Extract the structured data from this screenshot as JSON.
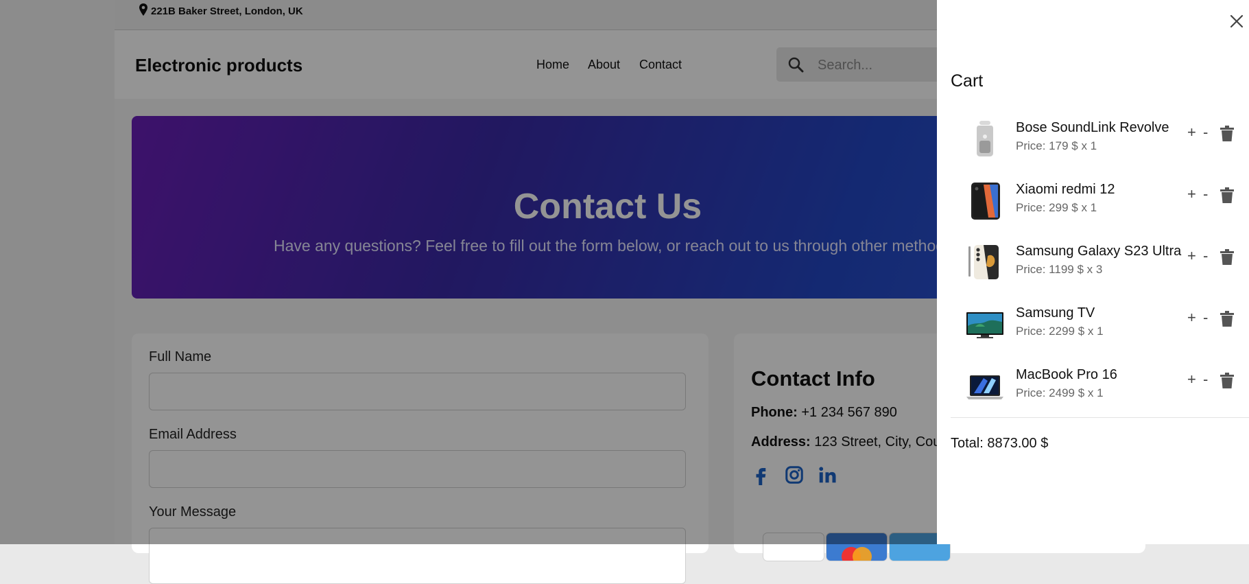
{
  "topbar": {
    "address": "221B Baker Street, London, UK"
  },
  "header": {
    "brand": "Electronic products",
    "nav": [
      "Home",
      "About",
      "Contact"
    ],
    "search_placeholder": "Search..."
  },
  "hero": {
    "title": "Contact Us",
    "subtitle": "Have any questions? Feel free to fill out the form below, or reach out to us through other methods"
  },
  "form": {
    "labels": [
      "Full Name",
      "Email Address",
      "Your Message"
    ]
  },
  "contact_info": {
    "title": "Contact Info",
    "phone_label": "Phone:",
    "phone": "+1 234 567 890",
    "address_label": "Address:",
    "address": "123 Street, City, Cou",
    "social_icons": [
      "facebook-icon",
      "instagram-icon",
      "linkedin-icon"
    ],
    "social_color": "#1d63c6"
  },
  "cart": {
    "title": "Cart",
    "items": [
      {
        "name": "Bose SoundLink Revolve",
        "price": "Price: 179 $ x 1",
        "icon": "speaker-image"
      },
      {
        "name": "Xiaomi redmi 12",
        "price": "Price: 299 $ x 1",
        "icon": "phone-image"
      },
      {
        "name": "Samsung Galaxy S23 Ultra",
        "price": "Price: 1199 $ x 3",
        "icon": "phone-image"
      },
      {
        "name": "Samsung TV",
        "price": "Price: 2299 $ x 1",
        "icon": "tv-image"
      },
      {
        "name": "MacBook Pro 16",
        "price": "Price: 2499 $ x 1",
        "icon": "laptop-image"
      }
    ],
    "plus_label": "+",
    "minus_label": "-",
    "total": "Total: 8873.00 $"
  }
}
